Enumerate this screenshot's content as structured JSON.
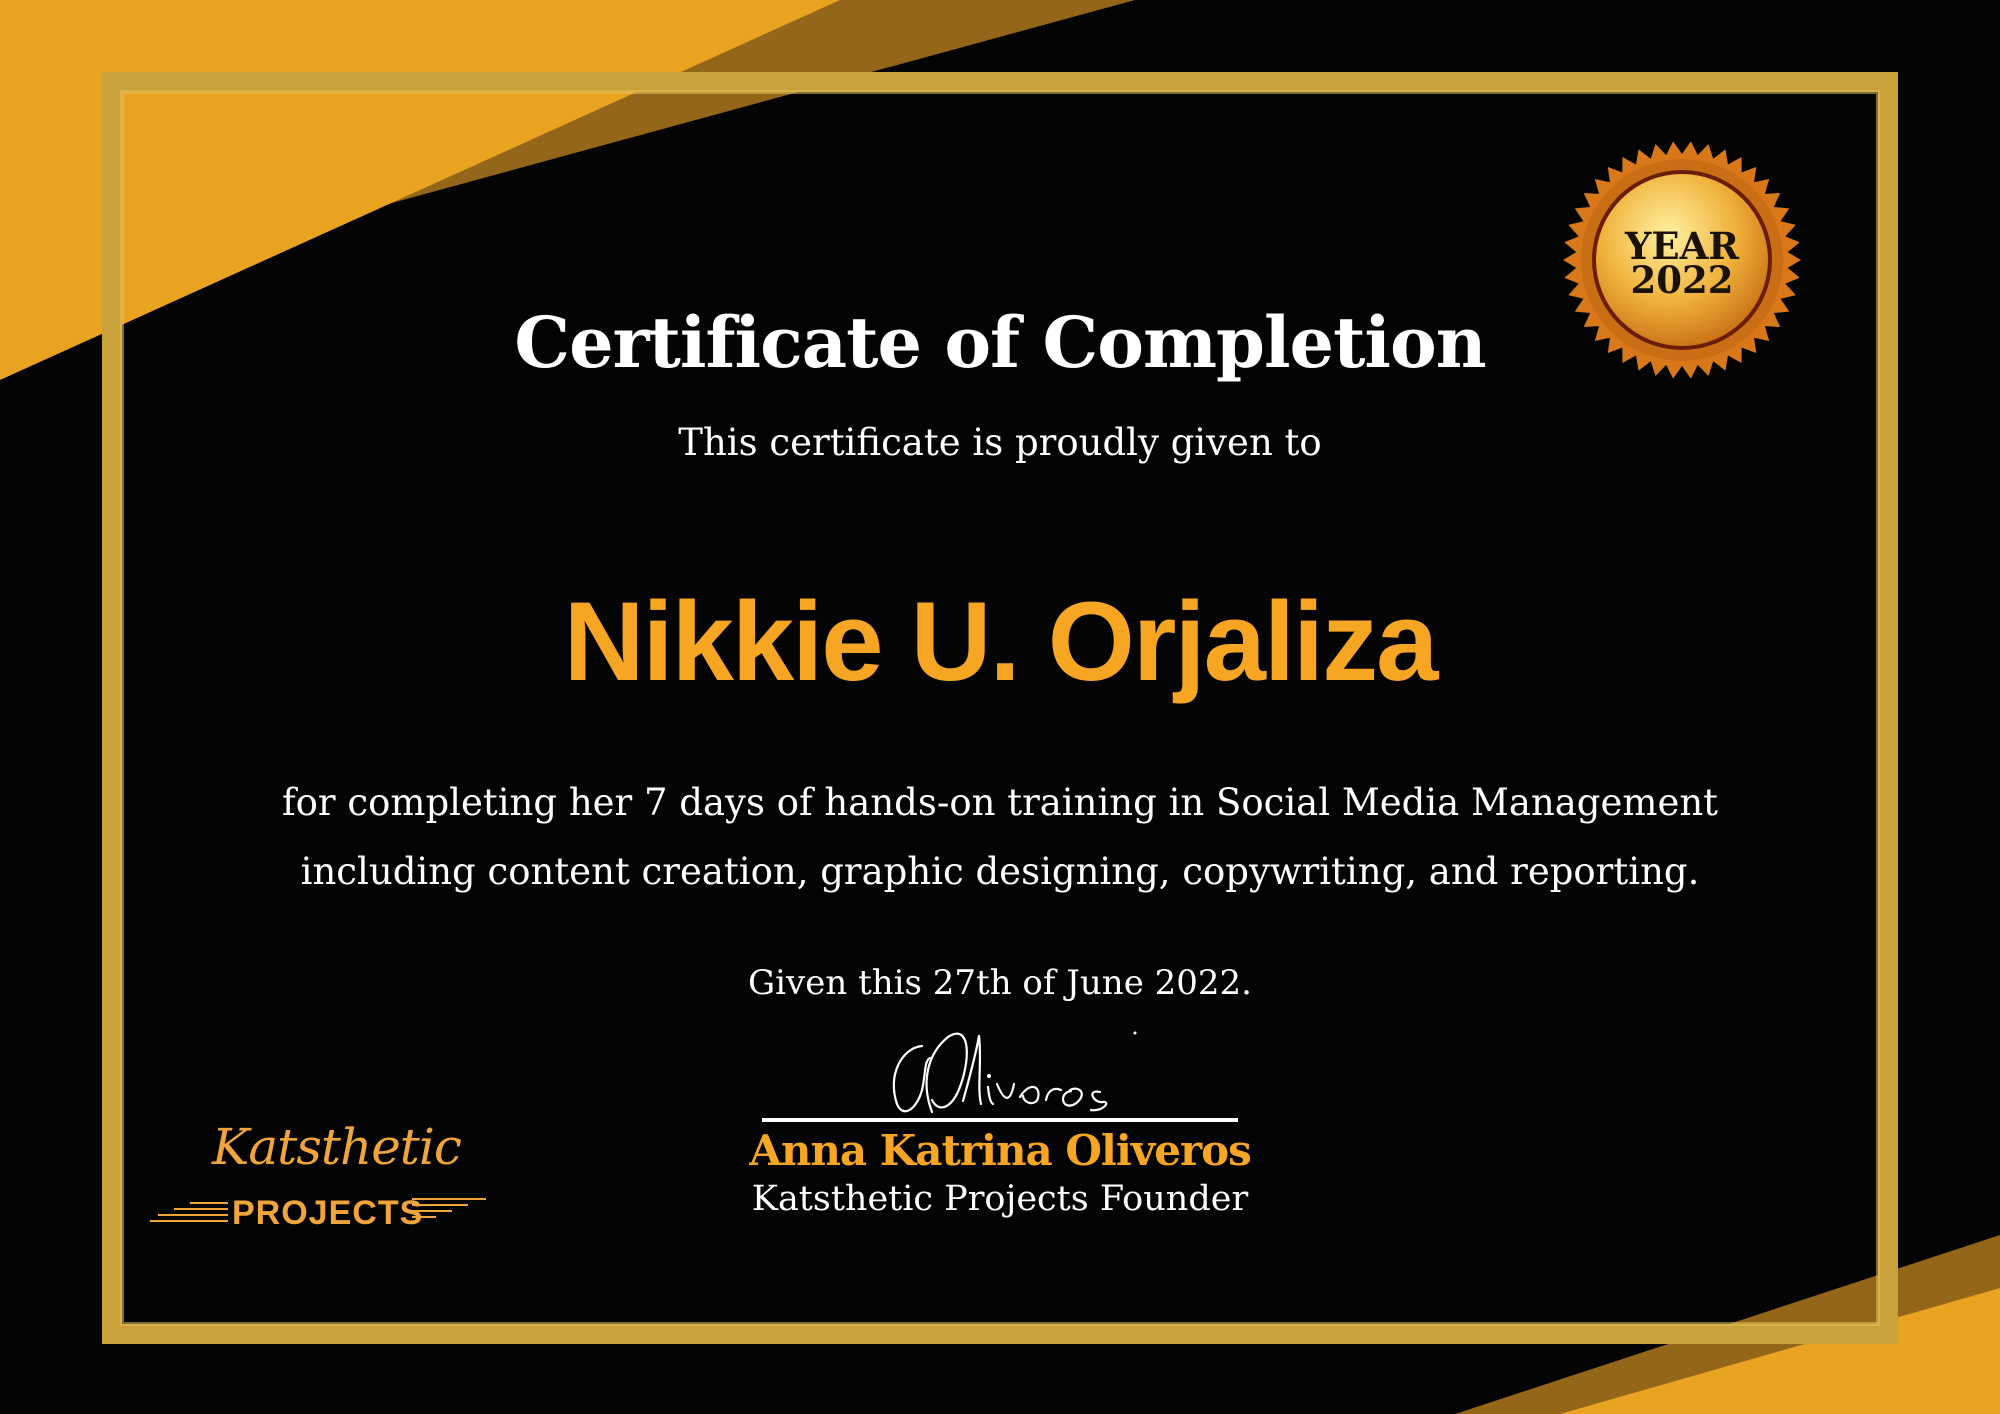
{
  "certificate": {
    "title": "Certificate of Completion",
    "subtitle": "This certificate is proudly given to",
    "recipient": "Nikkie U. Orjaliza",
    "description_lines": [
      "for completing her 7 days of hands-on training in Social Media Management",
      "including content creation, graphic designing,  copywriting, and reporting."
    ],
    "given_date": "Given this 27th of June 2022."
  },
  "seal": {
    "label": "YEAR",
    "year": "2022"
  },
  "signature": {
    "handwritten": "GOliveros",
    "name": "Anna Katrina Oliveros",
    "role": "Katsthetic Projects Founder"
  },
  "logo": {
    "script_text": "Katsthetic",
    "word_text": "PROJECTS"
  },
  "colors": {
    "background": "#040404",
    "gold": "#e8a321",
    "dark_gold": "#93661a",
    "accent_orange": "#f6a623",
    "frame": "#c9a13a",
    "text": "#ffffff"
  }
}
